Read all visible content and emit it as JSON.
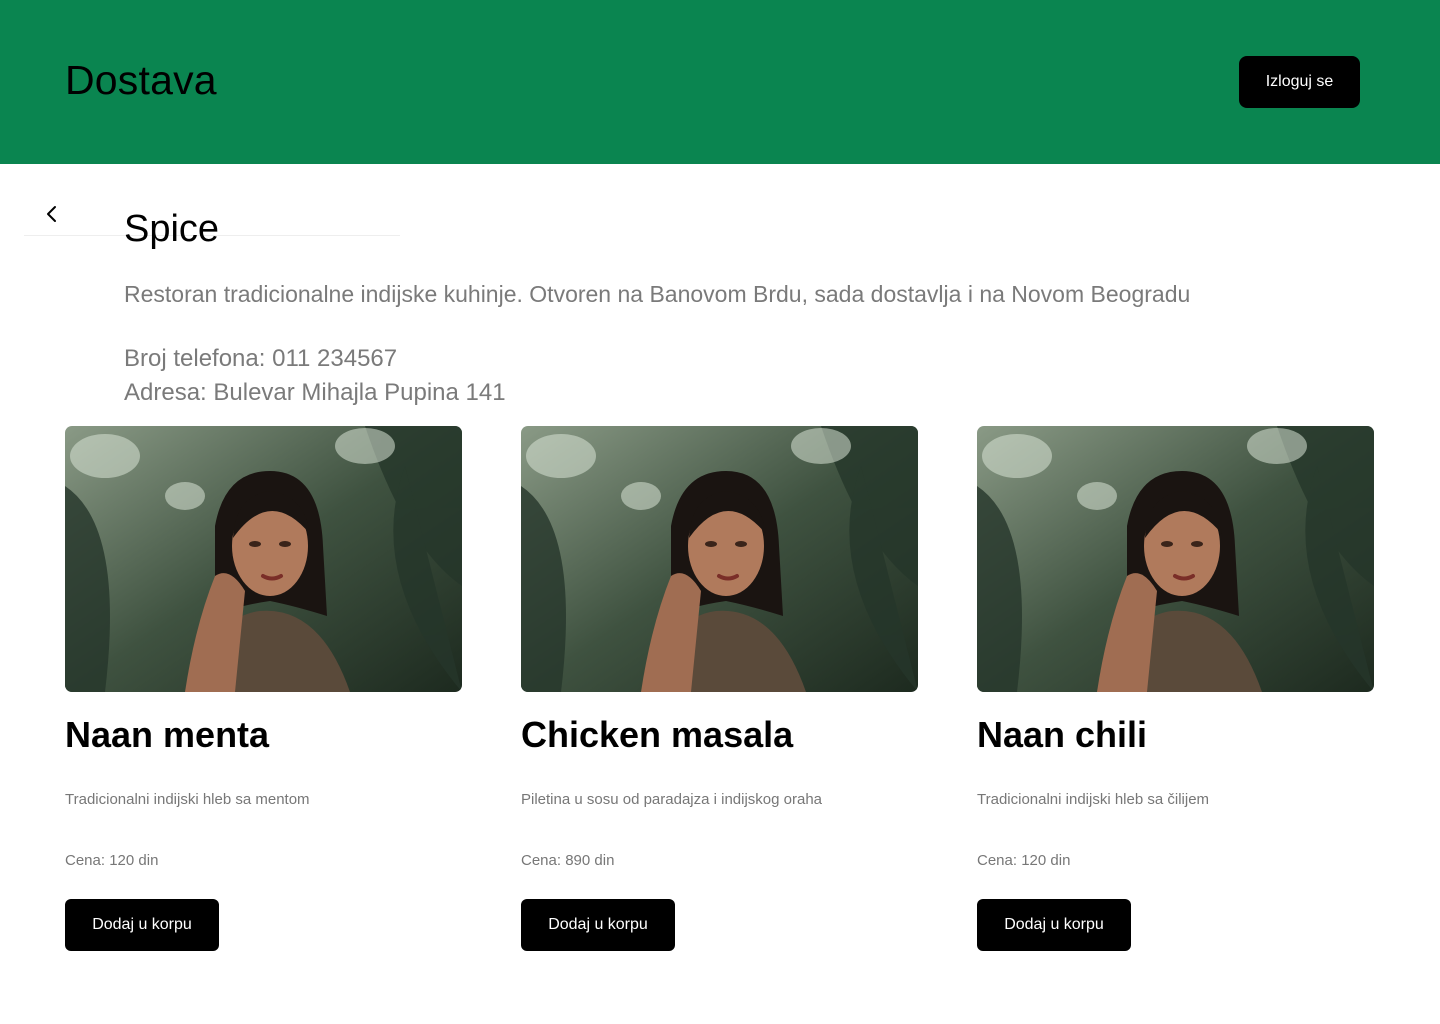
{
  "header": {
    "brand": "Dostava",
    "logout_label": "Izloguj se",
    "color": "#0a8550"
  },
  "restaurant": {
    "back_icon": "chevron-left-icon",
    "name": "Spice",
    "description": "Restoran tradicionalne indijske kuhinje. Otvoren na Banovom Brdu, sada dostavlja i na Novom Beogradu",
    "phone": "Broj telefona: 011 234567",
    "address": "Adresa: Bulevar Mihajla Pupina 141"
  },
  "menu": [
    {
      "name": "Naan menta",
      "description": "Tradicionalni indijski hleb sa mentom",
      "price": "Cena: 120 din",
      "button": "Dodaj u korpu",
      "image": "woman-portrait-photo"
    },
    {
      "name": "Chicken masala",
      "description": "Piletina u sosu od paradajza i indijskog oraha",
      "price": "Cena: 890 din",
      "button": "Dodaj u korpu",
      "image": "woman-portrait-photo"
    },
    {
      "name": "Naan chili",
      "description": "Tradicionalni indijski hleb sa čilijem",
      "price": "Cena: 120 din",
      "button": "Dodaj u korpu",
      "image": "woman-portrait-photo"
    }
  ]
}
